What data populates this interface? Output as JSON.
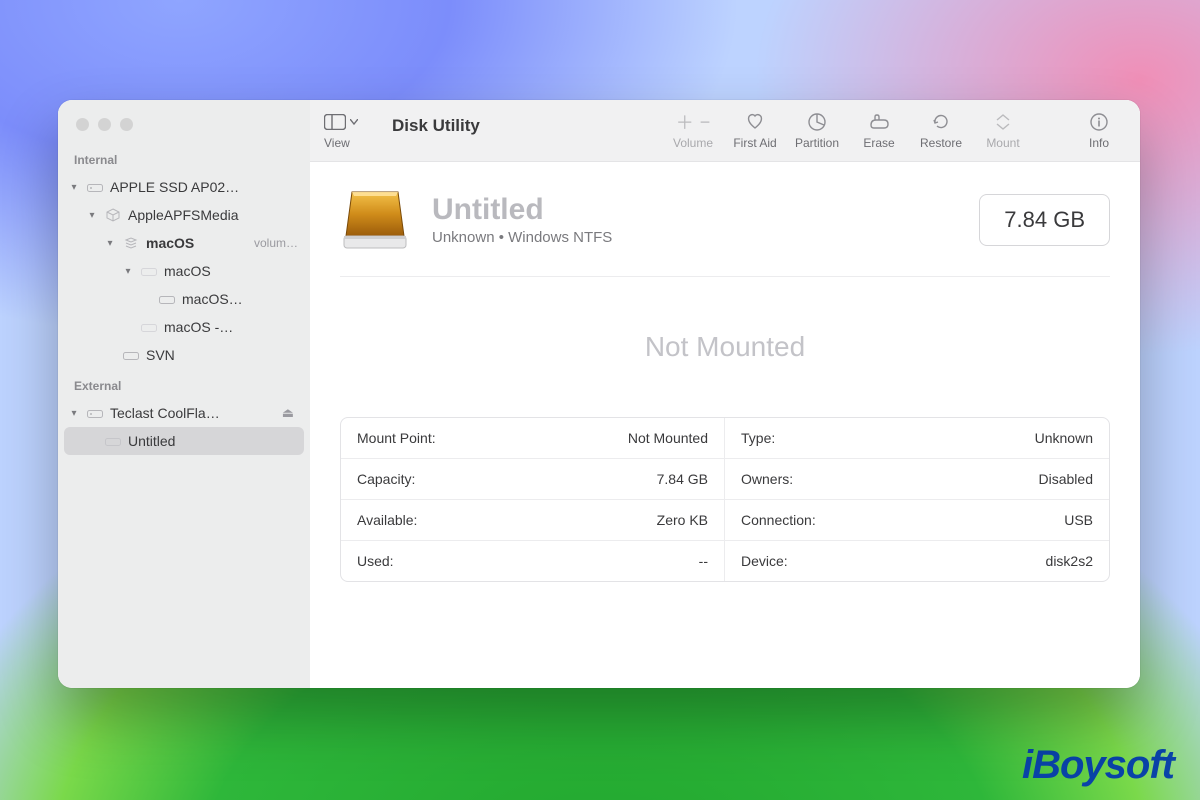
{
  "app_title": "Disk Utility",
  "toolbar": {
    "view_label": "View",
    "volume_label": "Volume",
    "first_aid_label": "First Aid",
    "partition_label": "Partition",
    "erase_label": "Erase",
    "restore_label": "Restore",
    "mount_label": "Mount",
    "info_label": "Info"
  },
  "sidebar": {
    "section_internal": "Internal",
    "section_external": "External",
    "internal": {
      "disk0": "APPLE SSD AP02…",
      "media": "AppleAPFSMedia",
      "container": "macOS",
      "container_sub": "volum…",
      "vg": "macOS",
      "vol_data": "macOS…",
      "vol_snap": "macOS -…",
      "vol_svn": "SVN"
    },
    "external": {
      "disk": "Teclast CoolFla…",
      "vol": "Untitled"
    }
  },
  "volume": {
    "name": "Untitled",
    "subtitle": "Unknown • Windows NTFS",
    "capacity_badge": "7.84 GB",
    "status": "Not Mounted"
  },
  "props": {
    "mount_point_k": "Mount Point:",
    "mount_point_v": "Not Mounted",
    "type_k": "Type:",
    "type_v": "Unknown",
    "capacity_k": "Capacity:",
    "capacity_v": "7.84 GB",
    "owners_k": "Owners:",
    "owners_v": "Disabled",
    "available_k": "Available:",
    "available_v": "Zero KB",
    "connection_k": "Connection:",
    "connection_v": "USB",
    "used_k": "Used:",
    "used_v": "--",
    "device_k": "Device:",
    "device_v": "disk2s2"
  },
  "watermark": "iBoysoft"
}
